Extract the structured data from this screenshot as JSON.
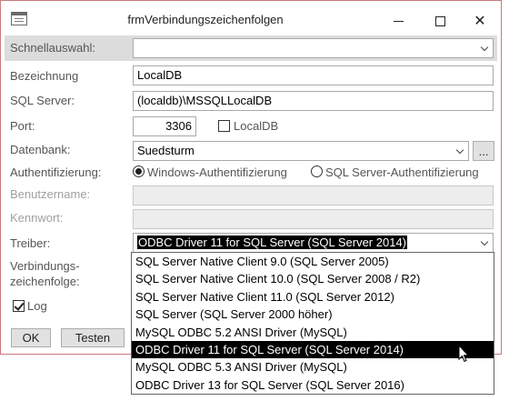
{
  "window": {
    "title": "frmVerbindungszeichenfolgen"
  },
  "form": {
    "schnellauswahl": {
      "label": "Schnellauswahl:",
      "value": ""
    },
    "bezeichnung": {
      "label": "Bezeichnung",
      "value": "LocalDB"
    },
    "sqlserver": {
      "label": "SQL Server:",
      "value": "(localdb)\\MSSQLLocalDB"
    },
    "port": {
      "label": "Port:",
      "value": "3306",
      "localdb_label": "LocalDB",
      "localdb_checked": false
    },
    "datenbank": {
      "label": "Datenbank:",
      "value": "Suedsturm",
      "browse_label": "..."
    },
    "authentifizierung": {
      "label": "Authentifizierung:",
      "options": [
        "Windows-Authentifizierung",
        "SQL Server-Authentifizierung"
      ],
      "selected": "Windows-Authentifizierung"
    },
    "benutzername": {
      "label": "Benutzername:",
      "value": ""
    },
    "kennwort": {
      "label": "Kennwort:",
      "value": ""
    },
    "treiber": {
      "label": "Treiber:",
      "value": "ODBC Driver 11 for SQL Server (SQL Server 2014)"
    },
    "verbindungszeichenfolge": {
      "label_line1": "Verbindungs-",
      "label_line2": "zeichenfolge:"
    },
    "log": {
      "label": "Log",
      "checked": true
    },
    "buttons": {
      "ok": "OK",
      "testen": "Testen"
    }
  },
  "treiber_dropdown": {
    "items": [
      "SQL Server Native Client 9.0 (SQL Server 2005)",
      "SQL Server Native Client 10.0 (SQL Server 2008 / R2)",
      "SQL Server Native Client 11.0 (SQL Server 2012)",
      "SQL Server (SQL Server 2000 höher)",
      "MySQL ODBC 5.2 ANSI Driver (MySQL)",
      "ODBC Driver 11 for SQL Server (SQL Server 2014)",
      "MySQL ODBC 5.3 ANSI Driver (MySQL)",
      "ODBC Driver 13 for SQL Server (SQL Server 2016)"
    ],
    "selected_index": 5
  }
}
